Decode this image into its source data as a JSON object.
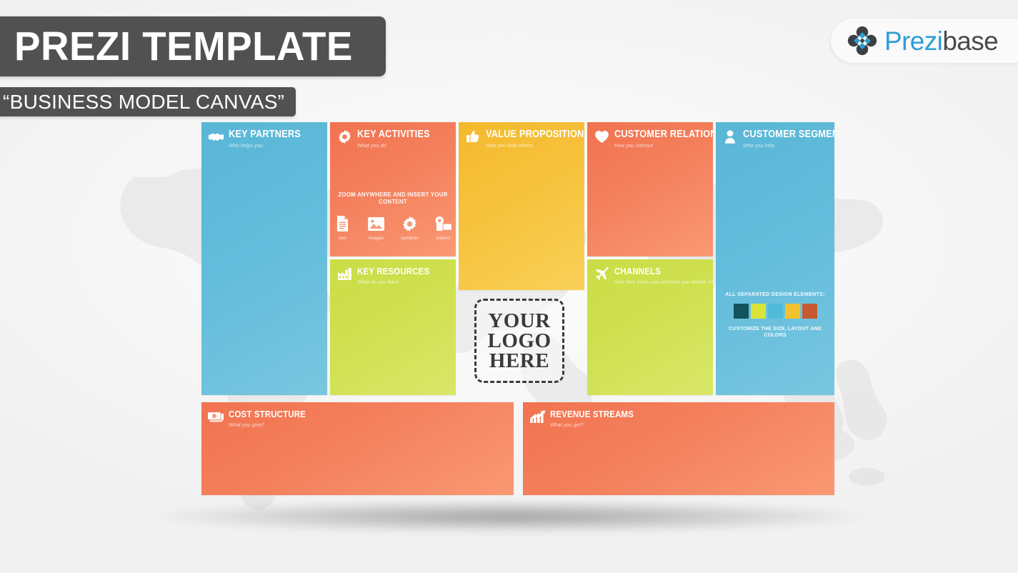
{
  "header": {
    "title": "PREZI TEMPLATE",
    "subtitle": "“BUSINESS MODEL CANVAS”"
  },
  "brand": {
    "name_part1": "Prezi",
    "name_part2": "base",
    "logo_icon": "prezibase-pinwheel-icon",
    "color_blue": "#2e9ed6",
    "color_dark": "#4a4a4a"
  },
  "canvas": {
    "blocks": [
      {
        "id": "key-partners",
        "title": "KEY PARTNERS",
        "subtitle": "Who helps you",
        "icon": "handshake-icon",
        "color": "#5ab6d6"
      },
      {
        "id": "key-activities",
        "title": "KEY ACTIVITIES",
        "subtitle": "What you do",
        "icon": "gear-icon",
        "color": "#f2734f"
      },
      {
        "id": "value-propositions",
        "title": "VALUE PROPOSITIONS",
        "subtitle": "How you help others",
        "icon": "thumbs-up-icon",
        "color": "#f4b92e"
      },
      {
        "id": "customer-relationships",
        "title": "CUSTOMER RELATIONSHIPS",
        "subtitle": "How you interact",
        "icon": "heart-icon",
        "color": "#f2734f"
      },
      {
        "id": "customer-segments",
        "title": "CUSTOMER SEGMENTS",
        "subtitle": "Who you help",
        "icon": "person-icon",
        "color": "#5ab6d6"
      },
      {
        "id": "key-resources",
        "title": "KEY RESOURCES",
        "subtitle": "What do you have",
        "icon": "factory-icon",
        "color": "#cadd45"
      },
      {
        "id": "channels",
        "title": "CHANNELS",
        "subtitle": "How they know you and how you deliver it?",
        "icon": "airplane-icon",
        "color": "#cadd45"
      },
      {
        "id": "cost-structure",
        "title": "COST STRUCTURE",
        "subtitle": "What you give?",
        "icon": "money-icon",
        "color": "#f2734f"
      },
      {
        "id": "revenue-streams",
        "title": "REVENUE STREAMS",
        "subtitle": "What you get?",
        "icon": "growth-chart-icon",
        "color": "#f2734f"
      }
    ]
  },
  "insert_content": {
    "caption": "ZOOM ANYWHERE AND INSERT YOUR CONTENT",
    "items": [
      {
        "label": "text",
        "icon": "document-icon"
      },
      {
        "label": "images",
        "icon": "picture-icon"
      },
      {
        "label": "symbols",
        "icon": "gear-icon"
      },
      {
        "label": "videos",
        "icon": "video-camera-icon"
      }
    ]
  },
  "design_elements": {
    "title": "ALL SEPARATED DESIGN ELEMENTS:",
    "footer": "CUSTOMIZE THE SIZE, LAYOUT AND COLORS",
    "swatches": [
      "#14535d",
      "#d9e33a",
      "#4ebcd9",
      "#f2c22e",
      "#c75a32"
    ]
  },
  "logo_placeholder": {
    "line1": "YOUR",
    "line2": "LOGO",
    "line3": "HERE"
  }
}
